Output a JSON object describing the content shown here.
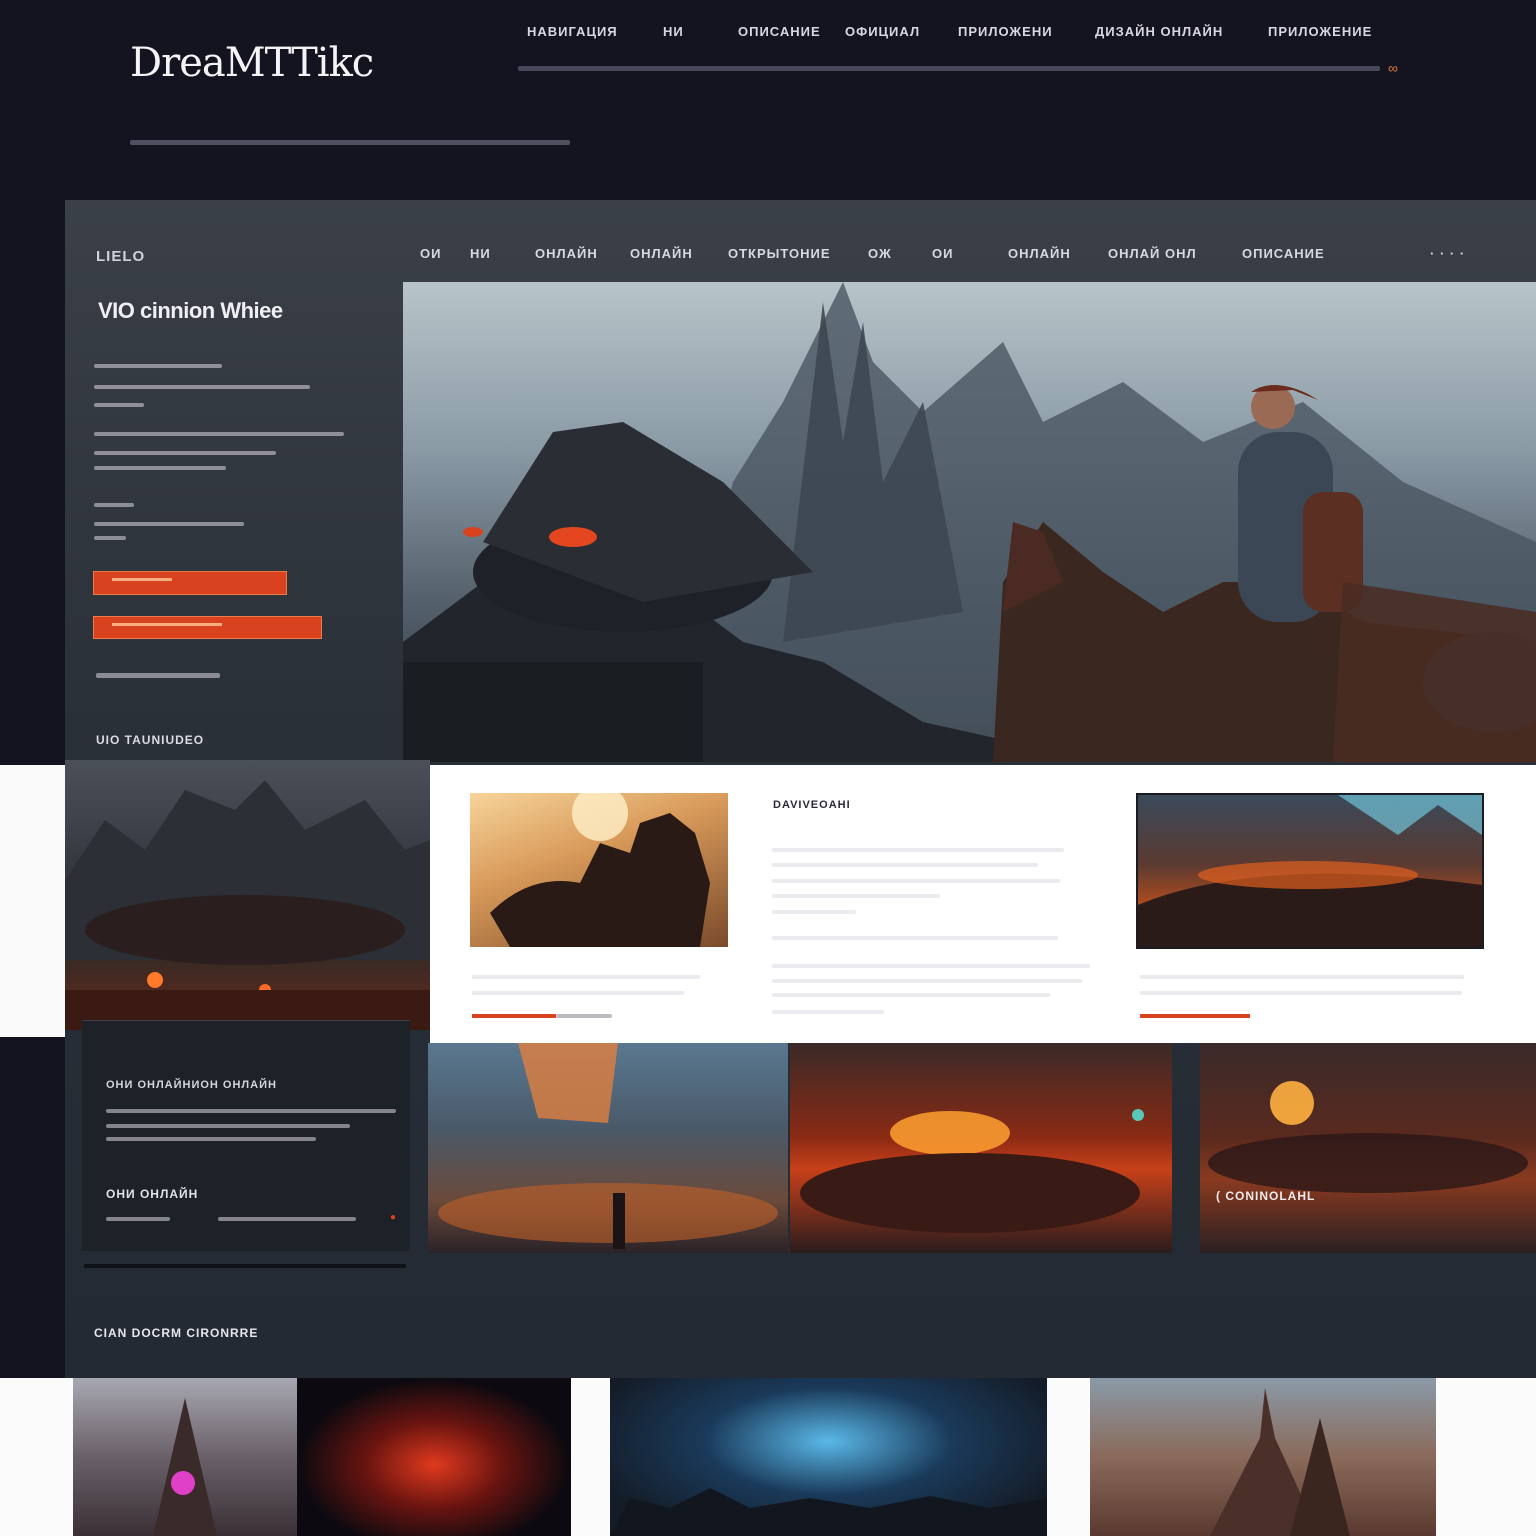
{
  "brand": {
    "title": "DreaMTTikc",
    "subtitle": "",
    "tagline": ""
  },
  "top_nav": [
    {
      "label": "НАВИГАЦИЯ"
    },
    {
      "label": "НИ"
    },
    {
      "label": "ОПИСАНИЕ"
    },
    {
      "label": "ОФИЦИАЛ"
    },
    {
      "label": "ПРИЛОЖЕНИ"
    },
    {
      "label": "ДИЗАЙН ОНЛАЙН"
    },
    {
      "label": "ПРИЛОЖЕНИЕ"
    }
  ],
  "panel": {
    "brand_short": "LIELO",
    "heading": "VIO cinnion Whiee",
    "links_title": "UIO TAUNIUDEO",
    "section_title": "CIAN DOCRM CIRONRRE"
  },
  "panel_nav": [
    {
      "label": "ОИ"
    },
    {
      "label": "НИ"
    },
    {
      "label": "ОНЛАЙН"
    },
    {
      "label": "ОНЛАЙН"
    },
    {
      "label": "ОТКРЫТОНИЕ"
    },
    {
      "label": "ОЖ"
    },
    {
      "label": "ОИ"
    },
    {
      "label": "ОНЛАЙН"
    },
    {
      "label": "ОНЛАЙ ОНЛ"
    },
    {
      "label": "ОПИСАНИЕ"
    }
  ],
  "content": {
    "card_label": "DAVIVEOAHI",
    "story_title": "ОНИ ОНЛАЙНИОН ОНЛАЙН",
    "story_link": "ОНИ ОНЛАЙН",
    "caption": "( CONINOLAHL"
  },
  "colors": {
    "accent": "#d9421f",
    "page_bg": "#141420",
    "panel_bg": "#2c3440",
    "card_bg": "#ffffff"
  }
}
